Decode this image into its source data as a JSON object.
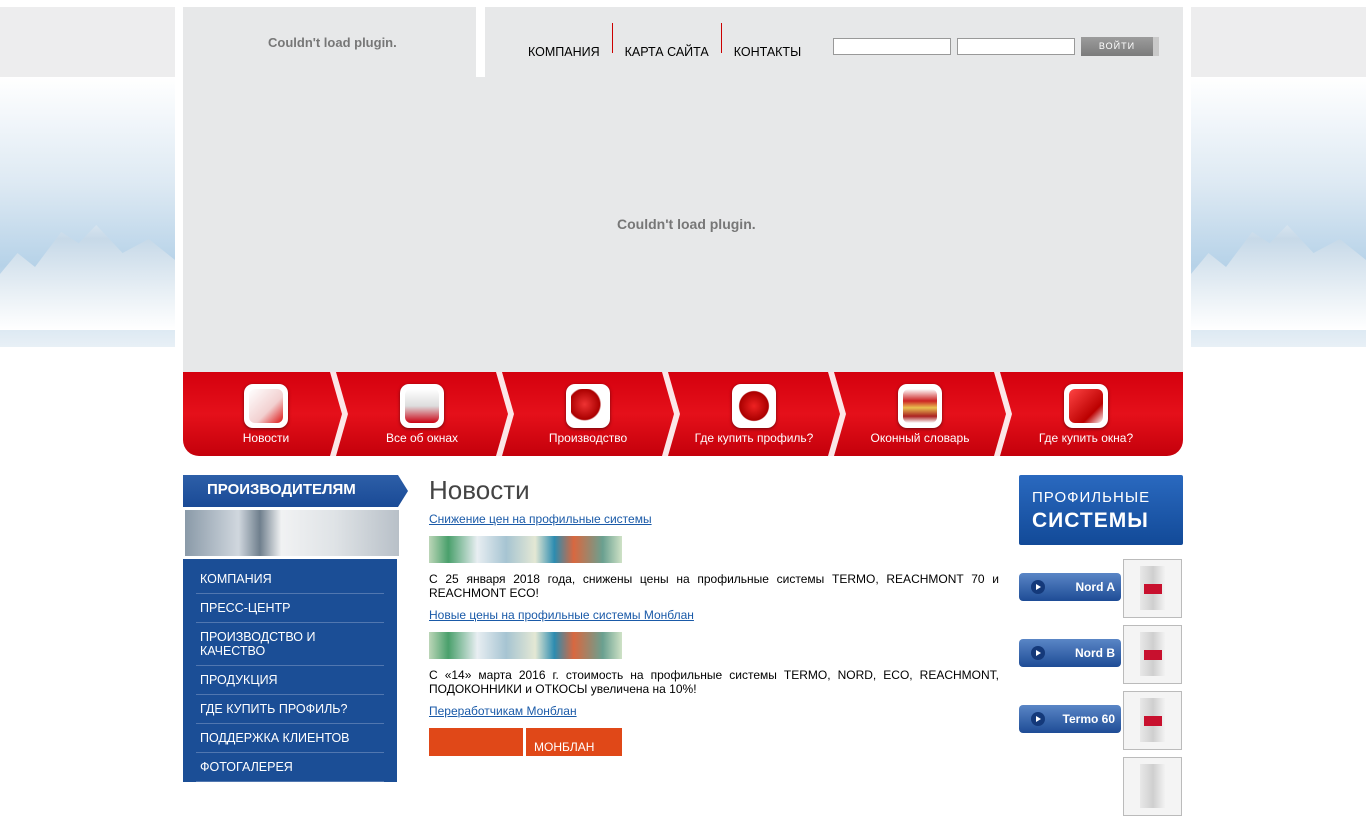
{
  "header": {
    "left_plugin_message": "Couldn't load plugin.",
    "nav": [
      "КОМПАНИЯ",
      "КАРТА САЙТА",
      "КОНТАКТЫ"
    ],
    "login": {
      "login_value": "",
      "password_value": "",
      "button_label": "ВОЙТИ"
    }
  },
  "flash": {
    "plugin_message": "Couldn't load plugin."
  },
  "main_menu": [
    {
      "label": "Новости",
      "icon": "news-icon"
    },
    {
      "label": "Все об окнах",
      "icon": "window-icon"
    },
    {
      "label": "Производство",
      "icon": "gears-icon"
    },
    {
      "label": "Где купить профиль?",
      "icon": "location-icon"
    },
    {
      "label": "Оконный словарь",
      "icon": "books-icon"
    },
    {
      "label": "Где купить окна?",
      "icon": "box-icon"
    }
  ],
  "left": {
    "title": "ПРОИЗВОДИТЕЛЯМ",
    "items": [
      "КОМПАНИЯ",
      "ПРЕСС-ЦЕНТР",
      "ПРОИЗВОДСТВО И КАЧЕСТВО",
      "ПРОДУКЦИЯ",
      "ГДЕ КУПИТЬ ПРОФИЛЬ?",
      "ПОДДЕРЖКА КЛИЕНТОВ",
      "ФОТОГАЛЕРЕЯ"
    ]
  },
  "main": {
    "title": "Новости",
    "news": [
      {
        "link": "Снижение цен на профильные системы",
        "text": "С 25 января 2018 года, снижены цены на профильные системы TERMO, REACHMONT 70 и REACHMONT ECO!"
      },
      {
        "link": "Новые цены на профильные системы Монблан",
        "text": "С «14» марта 2016 г. стоимость на профильные системы TERMO, NORD, ECO, REACHMONT, ПОДОКОННИКИ и ОТКОСЫ увеличена на 10%!"
      },
      {
        "link": "Переработчикам Монблан",
        "logo_text": "МОНБЛАН"
      }
    ]
  },
  "right": {
    "banner_line1": "ПРОФИЛЬНЫЕ",
    "banner_line2": "СИСТЕМЫ",
    "products": [
      "Nord A",
      "Nord B",
      "Termo 60"
    ]
  },
  "colors": {
    "red": "#d9000f",
    "blue": "#1b4e96",
    "link": "#1a5aa8"
  }
}
